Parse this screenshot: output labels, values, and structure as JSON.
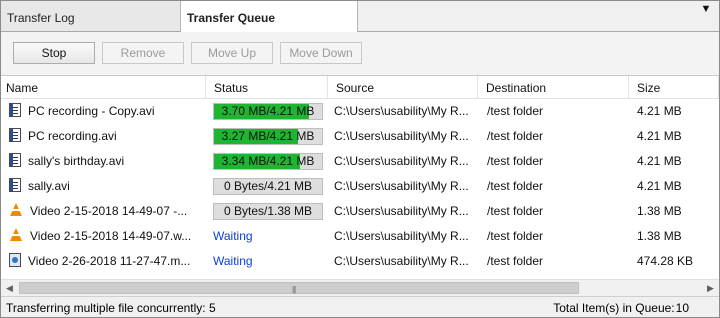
{
  "tabs": [
    {
      "label": "Transfer Log"
    },
    {
      "label": "Transfer Queue"
    }
  ],
  "tabbar": {
    "menu_icon": "chevron-down-icon"
  },
  "toolbar": {
    "stop_label": "Stop",
    "remove_label": "Remove",
    "move_up_label": "Move Up",
    "move_down_label": "Move Down"
  },
  "columns": {
    "name": "Name",
    "status": "Status",
    "source": "Source",
    "destination": "Destination",
    "size": "Size"
  },
  "rows": [
    {
      "name": "PC recording - Copy.avi",
      "icon": "video-file-icon",
      "status": "3.70 MB/4.21 MB",
      "progress": 0.879,
      "source": "C:\\Users\\usability\\My R...",
      "destination": "/test folder",
      "size": "4.21 MB"
    },
    {
      "name": "PC recording.avi",
      "icon": "video-file-icon",
      "status": "3.27 MB/4.21 MB",
      "progress": 0.777,
      "source": "C:\\Users\\usability\\My R...",
      "destination": "/test folder",
      "size": "4.21 MB"
    },
    {
      "name": "sally's birthday.avi",
      "icon": "video-file-icon",
      "status": "3.34 MB/4.21 MB",
      "progress": 0.793,
      "source": "C:\\Users\\usability\\My R...",
      "destination": "/test folder",
      "size": "4.21 MB"
    },
    {
      "name": "sally.avi",
      "icon": "video-file-icon",
      "status": "0 Bytes/4.21 MB",
      "progress": 0,
      "source": "C:\\Users\\usability\\My R...",
      "destination": "/test folder",
      "size": "4.21 MB"
    },
    {
      "name": "Video 2-15-2018 14-49-07 -...",
      "icon": "vlc-cone-icon",
      "status": "0 Bytes/1.38 MB",
      "progress": 0,
      "source": "C:\\Users\\usability\\My R...",
      "destination": "/test folder",
      "size": "1.38 MB"
    },
    {
      "name": "Video 2-15-2018 14-49-07.w...",
      "icon": "vlc-cone-icon",
      "status": "Waiting",
      "progress": null,
      "source": "C:\\Users\\usability\\My R...",
      "destination": "/test folder",
      "size": "1.38 MB"
    },
    {
      "name": "Video 2-26-2018 11-27-47.m...",
      "icon": "media-file-icon",
      "status": "Waiting",
      "progress": null,
      "source": "C:\\Users\\usability\\My R...",
      "destination": "/test folder",
      "size": "474.28 KB"
    }
  ],
  "statusbar": {
    "left": "Transferring multiple file concurrently: 5",
    "right_label": "Total Item(s) in Queue:",
    "right_count": "10"
  },
  "colors": {
    "progress_fill": "#1fb532",
    "waiting_text": "#0b3fd6"
  }
}
